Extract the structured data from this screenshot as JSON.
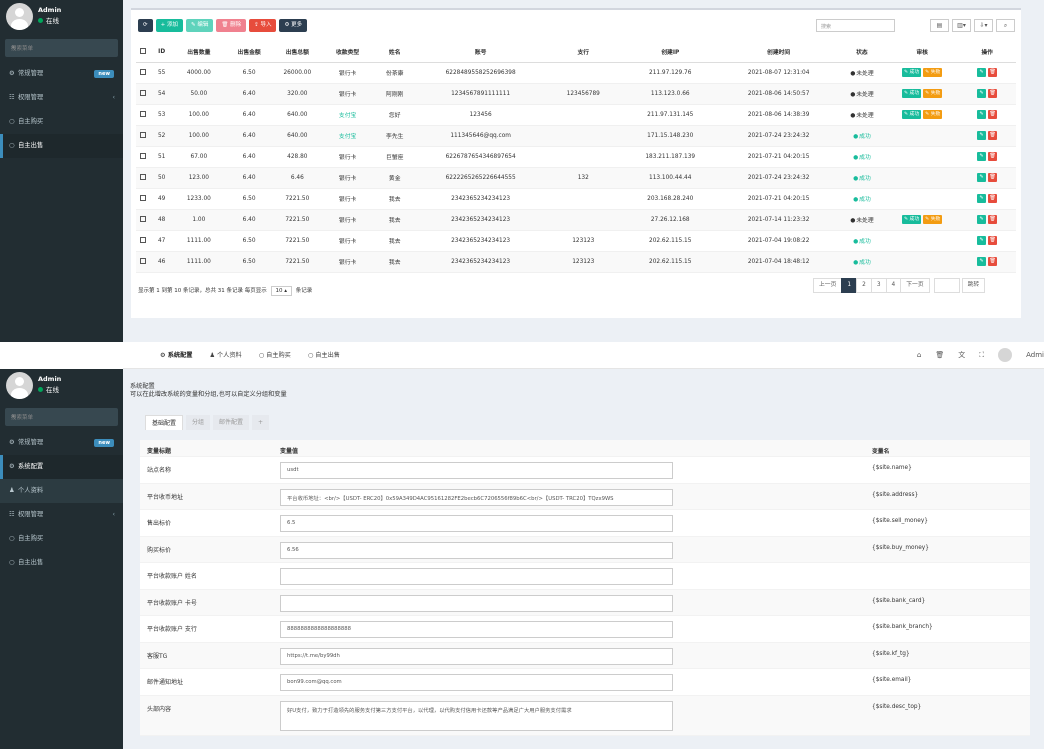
{
  "sidebar": {
    "user_name": "Admin",
    "status": "在线",
    "search_placeholder": "搜索菜单",
    "new_badge": "new"
  },
  "shot1": {
    "menu": [
      "常规管理",
      "权限管理",
      "自主购买",
      "自主出售"
    ],
    "toolbar": {
      "refresh": "⟳",
      "add": "添加",
      "edit": "编辑",
      "delete": "删除",
      "import": "导入",
      "more": "更多"
    },
    "search_placeholder": "搜索",
    "columns": [
      "ID",
      "出售数量",
      "出售金额",
      "出售总额",
      "收款类型",
      "姓名",
      "账号",
      "支行",
      "创建IP",
      "创建时间",
      "状态",
      "审核",
      "操作"
    ],
    "rows": [
      [
        "55",
        "4000.00",
        "6.50",
        "26000.00",
        "银行卡",
        "份茶康",
        "6228489558252696398",
        "",
        "211.97.129.76",
        "2021-08-07 12:31:04",
        "未处理",
        "audit"
      ],
      [
        "54",
        "50.00",
        "6.40",
        "320.00",
        "银行卡",
        "阿刚刚",
        "1234567891111111",
        "123456789",
        "113.123.0.66",
        "2021-08-06 14:50:57",
        "未处理",
        "audit"
      ],
      [
        "53",
        "100.00",
        "6.40",
        "640.00",
        "支付宝",
        "您好",
        "123456",
        "",
        "211.97.131.145",
        "2021-08-06 14:38:39",
        "未处理",
        "audit"
      ],
      [
        "52",
        "100.00",
        "6.40",
        "640.00",
        "支付宝",
        "李先生",
        "111345646@qq.com",
        "",
        "171.15.148.230",
        "2021-07-24 23:24:32",
        "成功",
        ""
      ],
      [
        "51",
        "67.00",
        "6.40",
        "428.80",
        "银行卡",
        "巨蟹座",
        "6226787654346897654",
        "",
        "183.211.187.139",
        "2021-07-21 04:20:15",
        "成功",
        ""
      ],
      [
        "50",
        "123.00",
        "6.40",
        "6.46",
        "银行卡",
        "黄金",
        "6222265265226644555",
        "132",
        "113.100.44.44",
        "2021-07-24 23:24:32",
        "成功",
        ""
      ],
      [
        "49",
        "1233.00",
        "6.50",
        "7221.50",
        "银行卡",
        "我去",
        "2342365234234123",
        "",
        "203.168.28.240",
        "2021-07-21 04:20:15",
        "成功",
        ""
      ],
      [
        "48",
        "1.00",
        "6.40",
        "7221.50",
        "银行卡",
        "我去",
        "2342365234234123",
        "",
        "27.26.12.168",
        "2021-07-14 11:23:32",
        "未处理",
        "audit"
      ],
      [
        "47",
        "1111.00",
        "6.50",
        "7221.50",
        "银行卡",
        "我去",
        "2342365234234123",
        "123123",
        "202.62.115.15",
        "2021-07-04 19:08:22",
        "成功",
        ""
      ],
      [
        "46",
        "1111.00",
        "6.50",
        "7221.50",
        "银行卡",
        "我去",
        "2342365234234123",
        "123123",
        "202.62.115.15",
        "2021-07-04 18:48:12",
        "成功",
        ""
      ]
    ],
    "audit_success": "成功",
    "audit_fail": "失败",
    "pager_info_a": "显示第 1 到第 10 条记录，总共 31 条记录 每页显示",
    "page_size": "10",
    "pager_info_b": "条记录",
    "pager": {
      "prev": "上一页",
      "pages": [
        "1",
        "2",
        "3",
        "4"
      ],
      "next": "下一页",
      "jump": "跳转"
    }
  },
  "shot2": {
    "topnav": [
      "系统配置",
      "个人资料",
      "自主购买",
      "自主出售"
    ],
    "top_user": "Admi",
    "menu": [
      "常规管理",
      "系统配置",
      "个人资料",
      "权限管理",
      "自主购买",
      "自主出售"
    ],
    "panel_title": "系统配置",
    "panel_desc": "可以在此增改系统的变量和分组,也可以自定义分组和变量",
    "subtabs": [
      "基础配置",
      "分组",
      "邮件配置",
      "+"
    ],
    "headers": {
      "title": "变量标题",
      "value": "变量值",
      "name": "变量名"
    },
    "config": [
      {
        "title": "站点名称",
        "value": "usdt",
        "name": "{$site.name}"
      },
      {
        "title": "平台收币地址",
        "value": "平台收币地址：<br/>【USDT- ERC20】0x59A349D4AC95161282FE2becb6C7206556f89b6C<br/>【USDT- TRC20】TQzx9WS",
        "name": "{$site.address}"
      },
      {
        "title": "售出标价",
        "value": "6.5",
        "name": "{$site.sell_money}"
      },
      {
        "title": "购买标价",
        "value": "6.56",
        "name": "{$site.buy_money}"
      },
      {
        "title": "平台收款账户 姓名",
        "value": "",
        "name": ""
      },
      {
        "title": "平台收款账户 卡号",
        "value": "",
        "name": "{$site.bank_card}"
      },
      {
        "title": "平台收款账户 支行",
        "value": "8888888888888888888",
        "name": "{$site.bank_branch}"
      },
      {
        "title": "客服TG",
        "value": "https://t.me/by99dh",
        "name": "{$site.kf_tg}"
      },
      {
        "title": "邮件通知地址",
        "value": "bon99.com@qq.com",
        "name": "{$site.email}"
      },
      {
        "title": "头部内容",
        "value": "好U支付，致力于打造领先的服务支付第三方支付平台，以代理，以代购支付信用卡还款等产品满足广大用户服务支付需求",
        "name": "{$site.desc_top}"
      }
    ]
  }
}
